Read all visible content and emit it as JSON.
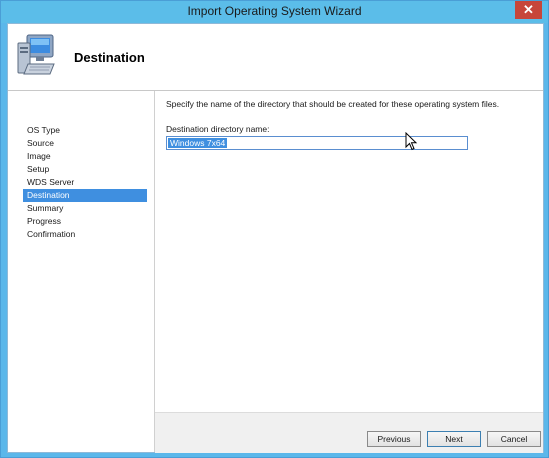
{
  "window": {
    "title": "Import Operating System Wizard",
    "close_symbol": "✕"
  },
  "header": {
    "title": "Destination",
    "icon": "computer-icon"
  },
  "sidebar": {
    "items": [
      {
        "label": "OS Type",
        "selected": false
      },
      {
        "label": "Source",
        "selected": false
      },
      {
        "label": "Image",
        "selected": false
      },
      {
        "label": "Setup",
        "selected": false
      },
      {
        "label": "WDS Server",
        "selected": false
      },
      {
        "label": "Destination",
        "selected": true
      },
      {
        "label": "Summary",
        "selected": false
      },
      {
        "label": "Progress",
        "selected": false
      },
      {
        "label": "Confirmation",
        "selected": false
      }
    ]
  },
  "content": {
    "instructions": "Specify the name of the directory that should be created for these operating system files.",
    "field_label": "Destination directory name:",
    "field_value": "Windows 7x64"
  },
  "buttons": {
    "previous": "Previous",
    "next": "Next",
    "cancel": "Cancel"
  },
  "colors": {
    "title_bar": "#5bbde9",
    "selection": "#3f8fe0",
    "close_button": "#c7463a"
  }
}
